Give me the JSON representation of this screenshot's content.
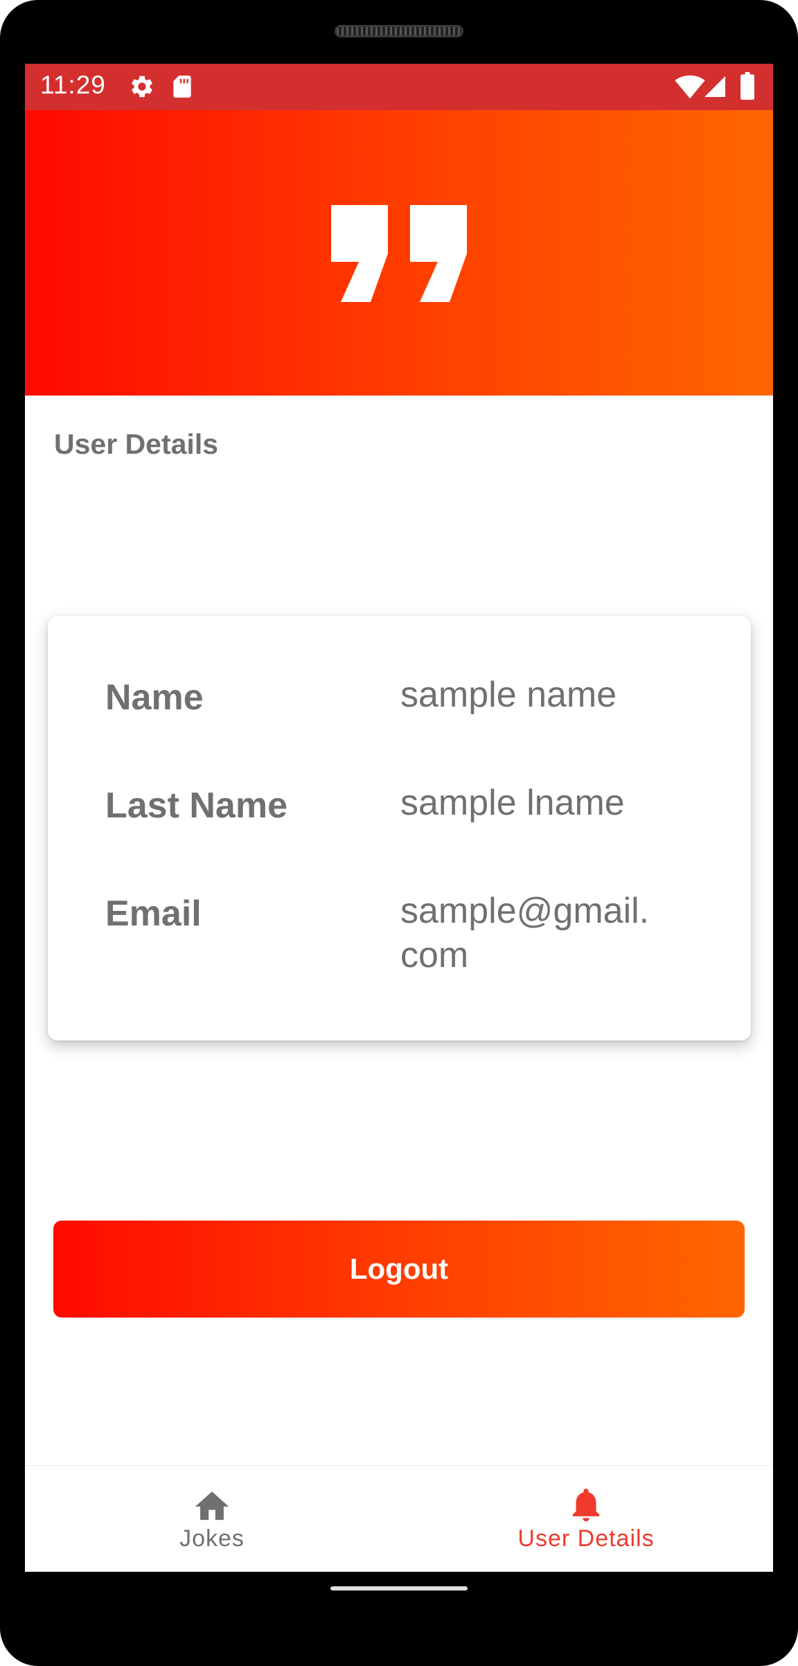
{
  "status_bar": {
    "time": "11:29",
    "left_icons": [
      "gear-icon",
      "sd-card-icon"
    ],
    "right_icons": [
      "wifi-icon",
      "signal-icon",
      "battery-icon"
    ],
    "background": "#d32f2f"
  },
  "header": {
    "logo_icon": "quote-icon",
    "gradient": [
      "#ff0a00",
      "#ff6600"
    ]
  },
  "page": {
    "title": "User Details"
  },
  "details": {
    "rows": [
      {
        "label": "Name",
        "value": "sample name"
      },
      {
        "label": "Last Name",
        "value": "sample lname"
      },
      {
        "label": "Email",
        "value": "sample@gmail.com"
      }
    ]
  },
  "actions": {
    "logout_label": "Logout"
  },
  "bottom_nav": {
    "items": [
      {
        "label": "Jokes",
        "icon": "home-icon",
        "active": false,
        "color": "#707070"
      },
      {
        "label": "User Details",
        "icon": "bell-icon",
        "active": true,
        "color": "#f03a2e"
      }
    ]
  }
}
